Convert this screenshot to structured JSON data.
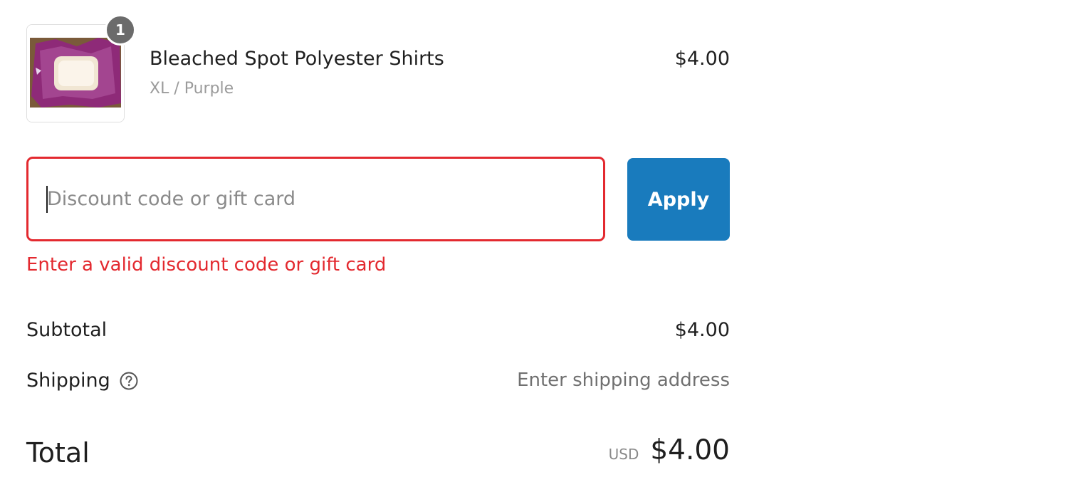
{
  "product": {
    "quantity": "1",
    "title": "Bleached Spot Polyester Shirts",
    "variant": "XL / Purple",
    "price": "$4.00",
    "image_icon": "product-thumbnail"
  },
  "discount": {
    "placeholder": "Discount code or gift card",
    "value": "",
    "apply_label": "Apply",
    "error": "Enter a valid discount code or gift card"
  },
  "totals": {
    "subtotal_label": "Subtotal",
    "subtotal_value": "$4.00",
    "shipping_label": "Shipping",
    "shipping_help_icon": "question-circle-icon",
    "shipping_value": "Enter shipping address",
    "total_label": "Total",
    "currency": "USD",
    "total_value": "$4.00"
  },
  "colors": {
    "error": "#e3292f",
    "button": "#197bbd",
    "badge": "#6b6b6b"
  }
}
